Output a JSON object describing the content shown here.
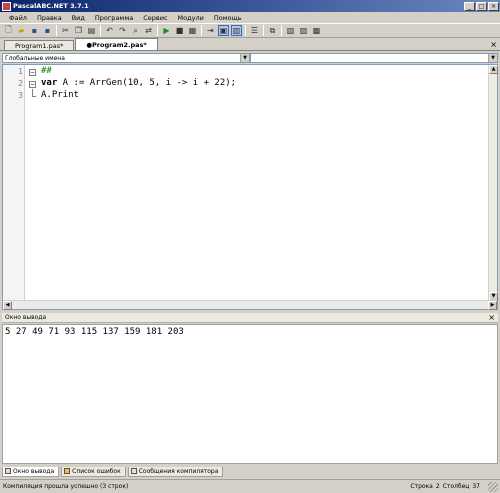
{
  "window": {
    "title": "PascalABC.NET 3.7.1"
  },
  "menu": [
    "Файл",
    "Правка",
    "Вид",
    "Программа",
    "Сервис",
    "Модули",
    "Помощь"
  ],
  "toolbar_icons": [
    "new-file-icon",
    "open-icon",
    "save-icon",
    "save-all-icon",
    "cut-icon",
    "copy-icon",
    "paste-icon",
    "undo-icon",
    "redo-icon",
    "find-icon",
    "replace-icon",
    "run-icon",
    "stop-icon",
    "debug-icon",
    "step-over-icon",
    "step-into-icon",
    "layout-icon",
    "layout-split-icon",
    "format-icon",
    "windows-icon",
    "settings-icon",
    "output-icon"
  ],
  "tabs": [
    {
      "label": "Program1.pas*",
      "active": false
    },
    {
      "label": "●Program2.pas*",
      "active": true
    }
  ],
  "combo_left": "Глобальные имена",
  "combo_right": "",
  "editor": {
    "line_numbers": [
      "1",
      "2",
      "3"
    ],
    "line1": "##",
    "line2_kw": "var",
    "line2_rest": " A := ArrGen(10, 5, i -> i + 22);",
    "line3": "A.Print"
  },
  "output": {
    "title": "Окно вывода",
    "text": "5 27 49 71 93 115 137 159 181 203"
  },
  "bottom_tabs": [
    "Окно вывода",
    "Список ошибок",
    "Сообщения компилятора"
  ],
  "status": {
    "message": "Компиляция прошла успешно (3 строк)",
    "row_label": "Строка",
    "row": "2",
    "col_label": "Столбец",
    "col": "37"
  }
}
